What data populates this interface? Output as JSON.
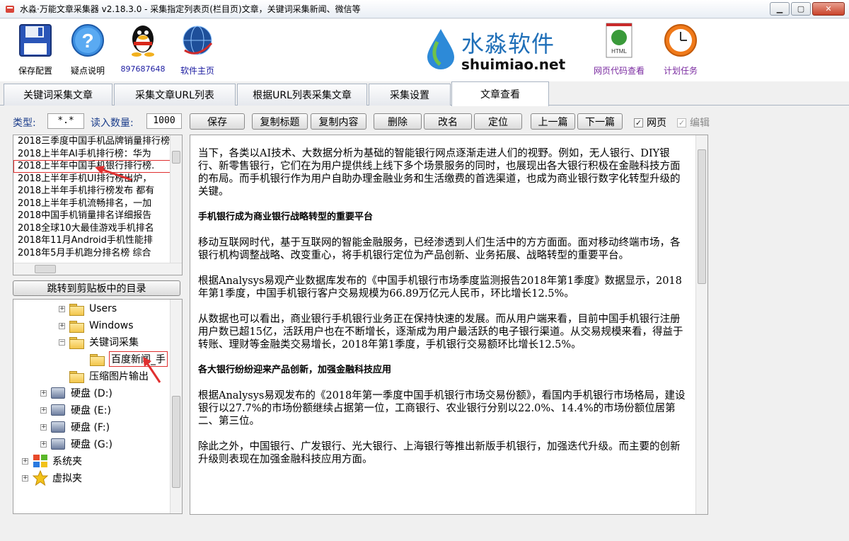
{
  "window": {
    "title": "水淼·万能文章采集器 v2.18.3.0 - 采集指定列表页(栏目页)文章，关键词采集新闻、微信等",
    "min": "▁",
    "max": "▢",
    "close": "✕"
  },
  "toolbar": {
    "save_config": "保存配置",
    "help": "疑点说明",
    "qq": "897687648",
    "homepage": "软件主页",
    "html_view": "网页代码查看",
    "tasks": "计划任务"
  },
  "logo": {
    "cn": "水淼软件",
    "en": "shuimiao.net"
  },
  "tabs": [
    {
      "label": "关键词采集文章"
    },
    {
      "label": "采集文章URL列表"
    },
    {
      "label": "根据URL列表采集文章"
    },
    {
      "label": "采集设置"
    },
    {
      "label": "文章查看"
    }
  ],
  "controls": {
    "type_label": "类型:",
    "type_value": "*.*",
    "read_count_label": "读入数量:",
    "read_count_value": "1000",
    "save": "保存",
    "copy_title": "复制标题",
    "copy_content": "复制内容",
    "delete": "删除",
    "rename": "改名",
    "locate": "定位",
    "prev": "上一篇",
    "next": "下一篇",
    "web": "网页",
    "edit": "编辑"
  },
  "articles": [
    "2018三季度中国手机品牌销量排行榜",
    "2018上半年AI手机排行榜：华为",
    "2018上半年中国手机银行排行榜.",
    "2018上半年手机UI排行榜出炉，",
    "2018上半年手机排行榜发布 都有",
    "2018上半年手机流畅排名，一加",
    "2018中国手机销量排名详细报告",
    "2018全球10大最佳游戏手机排名",
    "2018年11月Android手机性能排",
    "2018年5月手机跑分排名榜 综合"
  ],
  "jump_button": "跳转到剪贴板中的目录",
  "tree": {
    "users": "Users",
    "windows": "Windows",
    "keyword": "关键词采集",
    "baidu": "百度新闻_手",
    "compress": "压缩图片输出",
    "drive_d": "硬盘 (D:)",
    "drive_e": "硬盘 (E:)",
    "drive_f": "硬盘 (F:)",
    "drive_g": "硬盘 (G:)",
    "system": "系统夹",
    "virtual": "虚拟夹"
  },
  "article": {
    "p1": "当下，各类以AI技术、大数据分析为基础的智能银行网点逐渐走进人们的视野。例如，无人银行、DIY银行、新零售银行，它们在为用户提供线上线下多个场景服务的同时，也展现出各大银行积极在金融科技方面的布局。而手机银行作为用户自助办理金融业务和生活缴费的首选渠道，也成为商业银行数字化转型升级的关键。",
    "h1": "手机银行成为商业银行战略转型的重要平台",
    "p2": "移动互联网时代，基于互联网的智能金融服务，已经渗透到人们生活中的方方面面。面对移动终端市场，各银行机构调整战略、改变重心，将手机银行定位为产品创新、业务拓展、战略转型的重要平台。",
    "p3": "根据Analysys易观产业数据库发布的《中国手机银行市场季度监测报告2018年第1季度》数据显示，2018年第1季度，中国手机银行客户交易规模为66.89万亿元人民币，环比增长12.5%。",
    "p4": "从数据也可以看出，商业银行手机银行业务正在保持快速的发展。而从用户端来看，目前中国手机银行注册用户数已超15亿，活跃用户也在不断增长，逐渐成为用户最活跃的电子银行渠道。从交易规模来看，得益于转账、理财等金融类交易增长，2018年第1季度，手机银行交易额环比增长12.5%。",
    "h2": "各大银行纷纷迎来产品创新，加强金融科技应用",
    "p5": "根据Analysys易观发布的《2018年第一季度中国手机银行市场交易份额》，看国内手机银行市场格局，建设银行以27.7%的市场份额继续占据第一位，工商银行、农业银行分别以22.0%、14.4%的市场份额位居第二、第三位。",
    "p6": "除此之外，中国银行、广发银行、光大银行、上海银行等推出新版手机银行，加强迭代升级。而主要的创新升级则表现在加强金融科技应用方面。"
  },
  "colors": {
    "label_blue": "#1a3c8a",
    "highlight_red": "#e03030",
    "logo_blue": "#1f6fb8"
  }
}
